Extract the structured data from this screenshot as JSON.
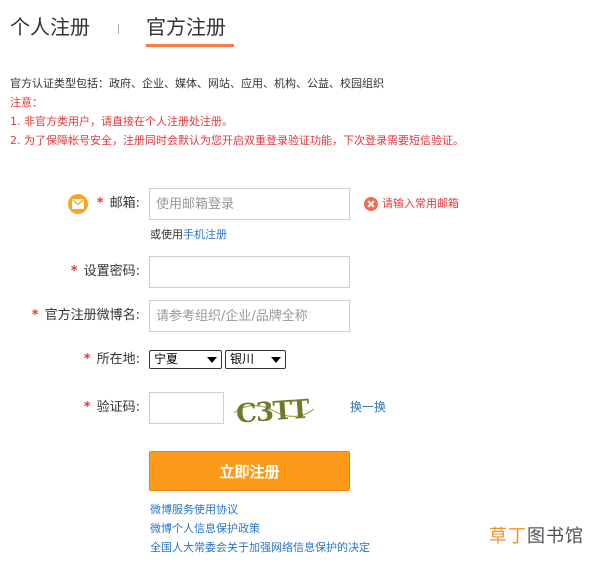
{
  "tabs": {
    "personal": "个人注册",
    "official": "官方注册"
  },
  "notice": {
    "types_line": "官方认证类型包括：政府、企业、媒体、网站、应用、机构、公益、校园组织",
    "note_title": "注意：",
    "line1_pre": "1. 非官方类用户，请直接在",
    "line1_link": "个人注册",
    "line1_post": "处注册。",
    "line2": "2. 为了保障帐号安全，注册同时会默认为您开启双重登录验证功能，下次登录需要短信验证。"
  },
  "form": {
    "email": {
      "label": "邮箱:",
      "placeholder": "使用邮箱登录",
      "error": "请输入常用邮箱",
      "alt_prefix": "或使用",
      "alt_link": "手机注册"
    },
    "password": {
      "label": "设置密码:"
    },
    "weibo_name": {
      "label": "官方注册微博名:",
      "placeholder": "请参考组织/企业/品牌全称"
    },
    "location": {
      "label": "所在地:",
      "province": "宁夏",
      "city": "银川"
    },
    "captcha": {
      "label": "验证码:",
      "image_text": "C3TT",
      "refresh": "换一换"
    },
    "submit": "立即注册"
  },
  "links": [
    "微博服务使用协议",
    "微博个人信息保护政策",
    "全国人大常委会关于加强网络信息保护的决定"
  ],
  "watermark": {
    "part1": "草丁",
    "part2": "图书馆"
  },
  "colors": {
    "accent": "#fa7d3c",
    "button": "#fe9a1a",
    "error": "#e4393c",
    "link": "#2a76c6"
  }
}
